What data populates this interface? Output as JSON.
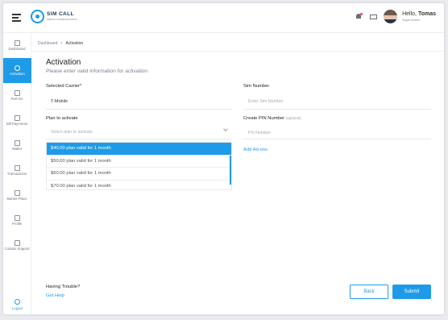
{
  "app": {
    "logo_title": "SIM CALL",
    "logo_subtitle": "SIMPLE COMMUNICATION",
    "user_greeting": "Hello,",
    "user_name": "Tomas",
    "user_role": "Super Admin",
    "accent_color": "#1e9be8"
  },
  "sidebar": {
    "items": [
      {
        "label": "Dashboard",
        "icon": "grid-icon"
      },
      {
        "label": "Activation",
        "icon": "phone-icon",
        "active": true
      },
      {
        "label": "Port-ins",
        "icon": "play-box-icon"
      },
      {
        "label": "Bill Payments",
        "icon": "money-icon"
      },
      {
        "label": "Wallet",
        "icon": "wallet-icon"
      },
      {
        "label": "Transactions",
        "icon": "transfer-icon"
      },
      {
        "label": "Market Place",
        "icon": "store-icon"
      },
      {
        "label": "Profile",
        "icon": "user-icon"
      },
      {
        "label": "Contact Support",
        "icon": "headset-icon"
      }
    ],
    "logout_label": "Logout"
  },
  "breadcrumb": {
    "root": "Dashboard",
    "current": "Activation"
  },
  "page": {
    "title": "Activation",
    "subtitle": "Please enter valid information for activation"
  },
  "form": {
    "carrier_label": "Selected Carrier*",
    "carrier_value": "T-Mobile",
    "sim_label": "Sim Number",
    "sim_placeholder": "Enter Sim Number",
    "plan_label": "Plan to activate",
    "plan_placeholder": "Select plan to activate",
    "pin_label": "Create PIN Number",
    "pin_optional": "(optional)",
    "pin_placeholder": "Pin Number",
    "add_ons": "Add Ad-ons",
    "plan_options": [
      {
        "label": "$40.00 plan valid for 1 month",
        "selected": true
      },
      {
        "label": "$50.00 plan valid for 1 month"
      },
      {
        "label": "$60.00 plan valid for 1 month"
      },
      {
        "label": "$70.00 plan valid for 1 month"
      }
    ]
  },
  "footer": {
    "trouble": "Having Trouble?",
    "help": "Get Help",
    "back": "Back",
    "submit": "Submit"
  }
}
